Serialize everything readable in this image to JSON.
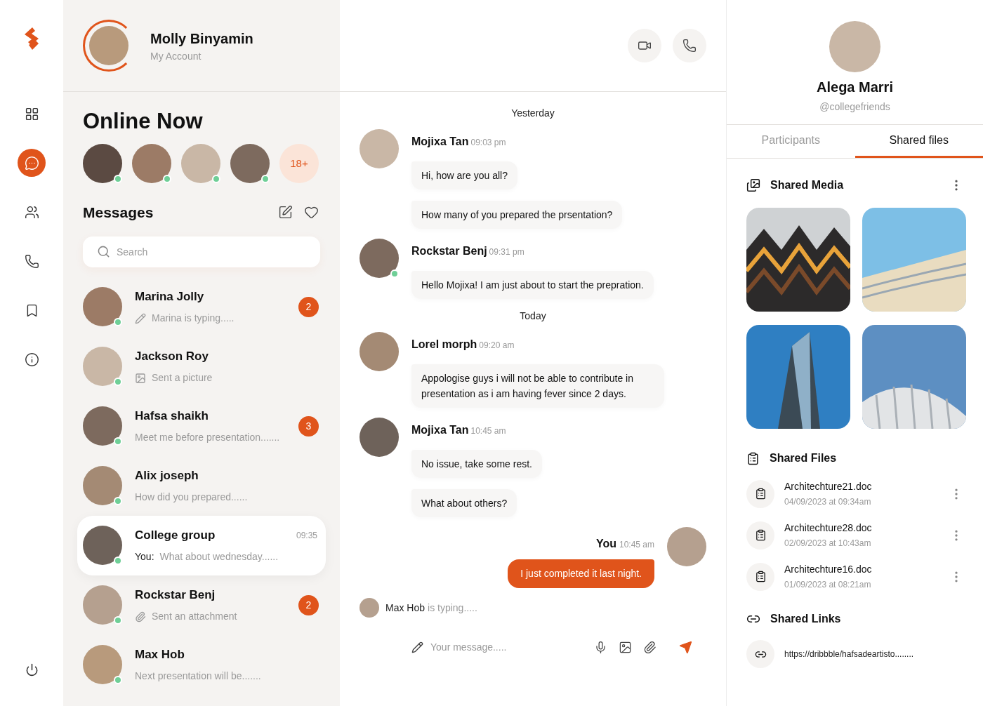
{
  "nav": {
    "items": [
      {
        "kind": "grid",
        "selected": false
      },
      {
        "kind": "chat",
        "selected": true
      },
      {
        "kind": "users",
        "selected": false
      },
      {
        "kind": "phone",
        "selected": false
      },
      {
        "kind": "bookmark",
        "selected": false
      },
      {
        "kind": "info",
        "selected": false
      }
    ],
    "bottom": {
      "kind": "power"
    }
  },
  "account": {
    "name": "Molly Binyamin",
    "subtitle": "My Account"
  },
  "online_now": {
    "title": "Online Now",
    "users": [
      {
        "online": true
      },
      {
        "online": true
      },
      {
        "online": true
      },
      {
        "online": true
      }
    ],
    "more": "18+"
  },
  "messages": {
    "title": "Messages",
    "search": {
      "placeholder": "Search"
    },
    "conversations": [
      {
        "name": "Marina Jolly",
        "preview": "Marina is typing.....",
        "kind": "typing",
        "unread": "2",
        "online": true,
        "selected": false
      },
      {
        "name": "Jackson Roy",
        "preview": "Sent a picture",
        "kind": "picture",
        "online": true,
        "selected": false
      },
      {
        "name": "Hafsa shaikh",
        "preview": "Meet me before presentation.......",
        "kind": "text",
        "unread": "3",
        "online": true,
        "selected": false
      },
      {
        "name": "Alix joseph",
        "preview": "How did you prepared......",
        "kind": "text",
        "online": true,
        "selected": false
      },
      {
        "name": "College group",
        "prefix": "You:",
        "preview": "What about wednesday......",
        "kind": "text",
        "time": "09:35",
        "online": true,
        "selected": true
      },
      {
        "name": "Rockstar Benj",
        "preview": "Sent an attachment",
        "kind": "attachment",
        "unread": "2",
        "online": true,
        "selected": false
      },
      {
        "name": "Max Hob",
        "preview": "Next presentation will be.......",
        "kind": "text",
        "online": true,
        "selected": false
      }
    ]
  },
  "chat": {
    "header_buttons": [
      {
        "kind": "video"
      },
      {
        "kind": "phone"
      }
    ],
    "days": [
      {
        "label": "Yesterday",
        "groups": [
          {
            "sender": "Mojixa Tan",
            "time": "09:03 pm",
            "online": false,
            "mine": false,
            "messages": [
              "Hi, how are you all?",
              "How many of you prepared the prsentation?"
            ]
          },
          {
            "sender": "Rockstar Benj",
            "time": "09:31 pm",
            "online": true,
            "mine": false,
            "messages": [
              "Hello Mojixa! I am just about to start the prepration."
            ]
          }
        ]
      },
      {
        "label": "Today",
        "groups": [
          {
            "sender": "Lorel morph",
            "time": "09:20 am",
            "online": false,
            "mine": false,
            "messages": [
              "Appologise guys i will not be able to contribute in presentation as i am having fever since 2 days."
            ]
          },
          {
            "sender": "Mojixa Tan",
            "time": "10:45 am",
            "online": false,
            "mine": false,
            "messages": [
              "No issue, take some rest.",
              "What about others?"
            ]
          },
          {
            "sender": "You",
            "time": "10:45 am",
            "online": false,
            "mine": true,
            "messages": [
              "I just completed it last night."
            ]
          }
        ]
      }
    ],
    "typing": {
      "name": "Max Hob",
      "text": "is typing....."
    },
    "composer": {
      "placeholder": "Your message.....",
      "tools": [
        {
          "kind": "mic"
        },
        {
          "kind": "image"
        },
        {
          "kind": "clip"
        },
        {
          "kind": "send"
        }
      ]
    }
  },
  "details": {
    "name": "Alega Marri",
    "handle": "@collegefriends",
    "tabs": [
      {
        "label": "Participants",
        "selected": false
      },
      {
        "label": "Shared files",
        "selected": true
      }
    ],
    "media": {
      "title": "Shared Media",
      "photos": [
        {
          "kind": "zigzag"
        },
        {
          "kind": "curved"
        },
        {
          "kind": "tower"
        },
        {
          "kind": "slats"
        }
      ]
    },
    "files": {
      "title": "Shared Files",
      "items": [
        {
          "name": "Architechture21.doc",
          "date": "04/09/2023 at 09:34am"
        },
        {
          "name": "Architechture28.doc",
          "date": "02/09/2023 at 10:43am"
        },
        {
          "name": "Architechture16.doc",
          "date": "01/09/2023 at 08:21am"
        }
      ]
    },
    "links": {
      "title": "Shared Links",
      "items": [
        {
          "url": "https://dribbble/hafsadeartisto........"
        }
      ]
    }
  }
}
